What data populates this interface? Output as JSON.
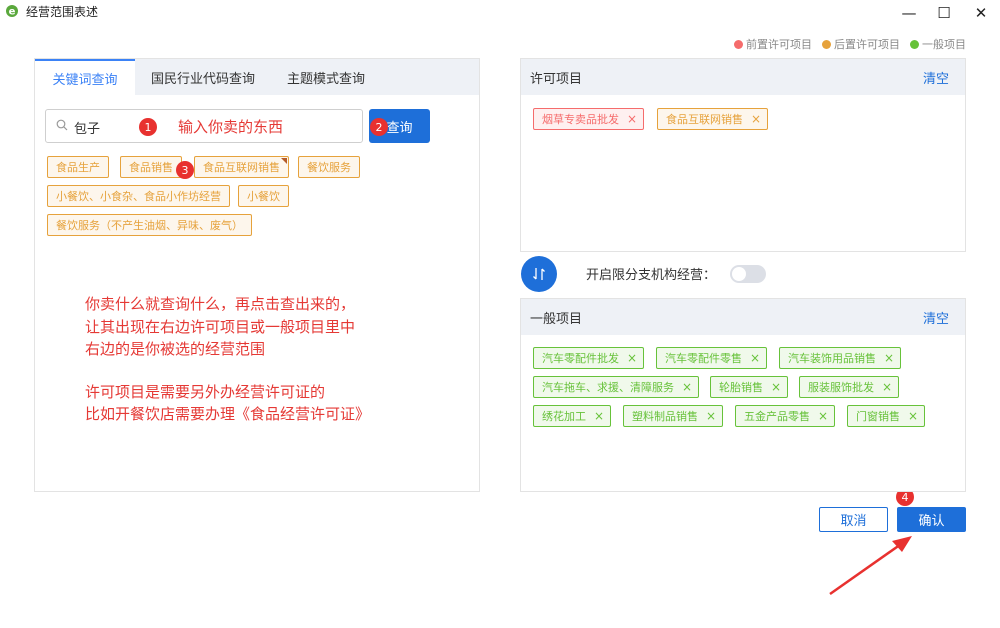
{
  "window": {
    "title": "经营范围表述",
    "minimize_glyph": "—",
    "maximize_glyph": "☐",
    "close_glyph": "✕"
  },
  "legend": [
    {
      "label": "前置许可项目",
      "color": "#f56c6c"
    },
    {
      "label": "后置许可项目",
      "color": "#e6a23c"
    },
    {
      "label": "一般项目",
      "color": "#67c23a"
    }
  ],
  "tabs": [
    {
      "label": "关键词查询",
      "active": true
    },
    {
      "label": "国民行业代码查询",
      "active": false
    },
    {
      "label": "主题模式查询",
      "active": false
    }
  ],
  "search": {
    "value": "包子",
    "button_label": "查询"
  },
  "keyword_results": [
    "食品生产",
    "食品销售",
    "食品互联网销售",
    "餐饮服务",
    "小餐饮、小食杂、食品小作坊经营",
    "小餐饮",
    "餐饮服务（不产生油烟、异味、废气）"
  ],
  "annotations": {
    "search_hint": "输入你卖的东西",
    "body_lines": [
      "你卖什么就查询什么，再点击查出来的，",
      "让其出现在右边许可项目或一般项目里中",
      "右边的是你被选的经营范围",
      "许可项目是需要另外办经营许可证的",
      "比如开餐饮店需要办理《食品经营许可证》"
    ],
    "badges": [
      "1",
      "2",
      "3",
      "4"
    ]
  },
  "licensed_panel": {
    "title": "许可项目",
    "clear_label": "清空",
    "tags": [
      {
        "label": "烟草专卖品批发",
        "kind": "red"
      },
      {
        "label": "食品互联网销售",
        "kind": "orange"
      }
    ]
  },
  "branch_toggle": {
    "label": "开启限分支机构经营：",
    "on": false
  },
  "general_panel": {
    "title": "一般项目",
    "clear_label": "清空",
    "tags": [
      "汽车零配件批发",
      "汽车零配件零售",
      "汽车装饰用品销售",
      "汽车拖车、求援、清障服务",
      "轮胎销售",
      "服装服饰批发",
      "绣花加工",
      "塑料制品销售",
      "五金产品零售",
      "门窗销售"
    ]
  },
  "tag_remove_glyph": "×",
  "footer": {
    "cancel_label": "取消",
    "confirm_label": "确认"
  },
  "colors": {
    "primary": "#1e6fd9",
    "annotation_red": "#e53935"
  }
}
